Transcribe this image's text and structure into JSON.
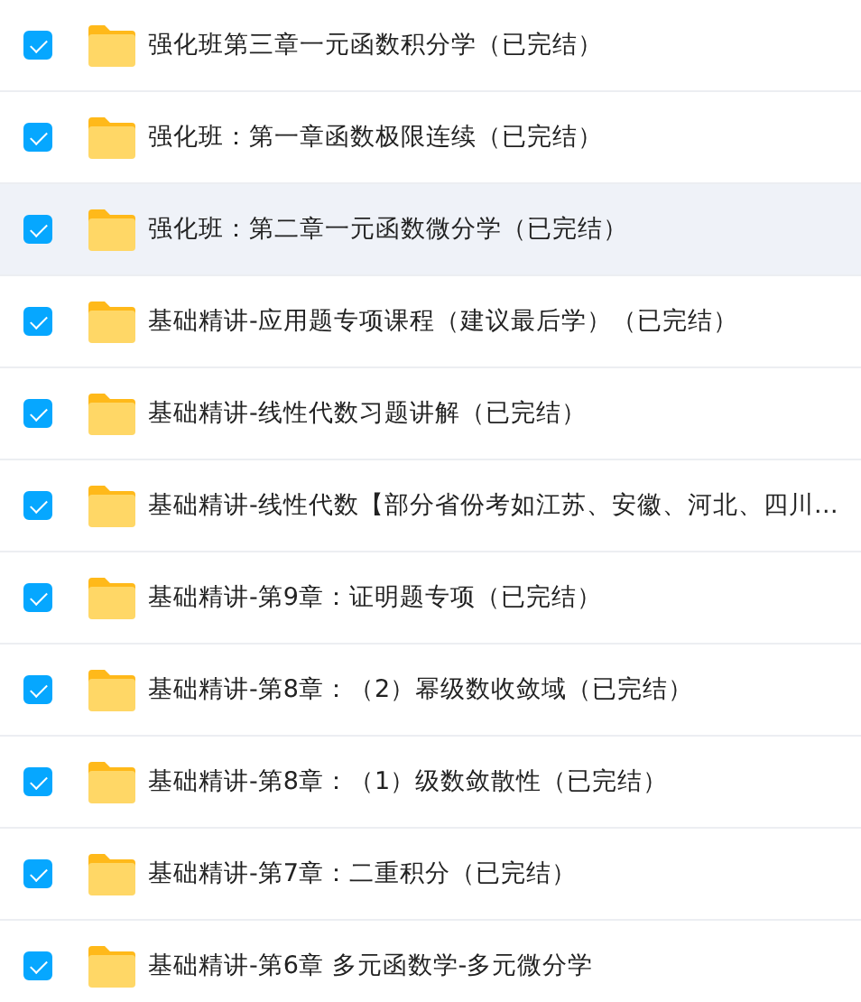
{
  "folders": [
    {
      "name": "强化班第三章一元函数积分学（已完结）",
      "checked": true,
      "highlighted": false
    },
    {
      "name": "强化班：第一章函数极限连续（已完结）",
      "checked": true,
      "highlighted": false
    },
    {
      "name": "强化班：第二章一元函数微分学（已完结）",
      "checked": true,
      "highlighted": true
    },
    {
      "name": "基础精讲-应用题专项课程（建议最后学）（已完结）",
      "checked": true,
      "highlighted": false
    },
    {
      "name": "基础精讲-线性代数习题讲解（已完结）",
      "checked": true,
      "highlighted": false
    },
    {
      "name": "基础精讲-线性代数【部分省份考如江苏、安徽、河北、四川…",
      "checked": true,
      "highlighted": false
    },
    {
      "name": "基础精讲-第9章：证明题专项（已完结）",
      "checked": true,
      "highlighted": false
    },
    {
      "name": "基础精讲-第8章：（2）幂级数收敛域（已完结）",
      "checked": true,
      "highlighted": false
    },
    {
      "name": "基础精讲-第8章：（1）级数敛散性（已完结）",
      "checked": true,
      "highlighted": false
    },
    {
      "name": "基础精讲-第7章：二重积分（已完结）",
      "checked": true,
      "highlighted": false
    },
    {
      "name": "基础精讲-第6章 多元函数学-多元微分学",
      "checked": true,
      "highlighted": false
    }
  ]
}
